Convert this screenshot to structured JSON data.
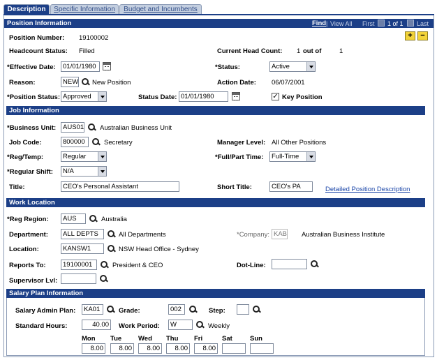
{
  "tabs": [
    "Description",
    "Specific Information",
    "Budget and Incumbents"
  ],
  "position_info": {
    "header": "Position Information",
    "nav": {
      "find": "Find",
      "view_all": "View All",
      "first": "First",
      "range": "1 of 1",
      "last": "Last"
    },
    "position_number_label": "Position Number:",
    "position_number": "19100002",
    "headcount_status_label": "Headcount Status:",
    "headcount_status": "Filled",
    "current_head_count_label": "Current Head Count:",
    "current_head_count": "1",
    "out_of_label": "out of",
    "max_head_count": "1",
    "effective_date_label": "*Effective Date:",
    "effective_date": "01/01/1980",
    "status_label": "*Status:",
    "status": "Active",
    "reason_label": "Reason:",
    "reason_code": "NEW",
    "reason_desc": "New Position",
    "action_date_label": "Action Date:",
    "action_date": "06/07/2001",
    "position_status_label": "*Position Status:",
    "position_status": "Approved",
    "status_date_label": "Status Date:",
    "status_date": "01/01/1980",
    "key_position_label": "Key Position",
    "key_position_checked": "✓"
  },
  "job_info": {
    "header": "Job Information",
    "business_unit_label": "*Business Unit:",
    "business_unit": "AUS01",
    "business_unit_desc": "Australian Business Unit",
    "job_code_label": "Job Code:",
    "job_code": "800000",
    "job_code_desc": "Secretary",
    "manager_level_label": "Manager Level:",
    "manager_level": "All Other Positions",
    "reg_temp_label": "*Reg/Temp:",
    "reg_temp": "Regular",
    "full_part_label": "*Full/Part Time:",
    "full_part": "Full-Time",
    "regular_shift_label": "*Regular Shift:",
    "regular_shift": "N/A",
    "title_label": "Title:",
    "title": "CEO's Personal Assistant",
    "short_title_label": "Short Title:",
    "short_title": "CEO's PA",
    "detailed_link": "Detailed Position Description"
  },
  "work_location": {
    "header": "Work Location",
    "reg_region_label": "*Reg Region:",
    "reg_region": "AUS",
    "reg_region_desc": "Australia",
    "department_label": "Department:",
    "department": "ALL DEPTS",
    "department_desc": "All Departments",
    "company_label": "*Company:",
    "company": "KAB",
    "company_desc": "Australian Business Institute",
    "location_label": "Location:",
    "location": "KANSW1",
    "location_desc": "NSW Head Office - Sydney",
    "reports_to_label": "Reports To:",
    "reports_to": "19100001",
    "reports_to_desc": "President & CEO",
    "dot_line_label": "Dot-Line:",
    "dot_line": "",
    "supervisor_lvl_label": "Supervisor Lvl:",
    "supervisor_lvl": ""
  },
  "salary_plan": {
    "header": "Salary Plan Information",
    "admin_plan_label": "Salary Admin Plan:",
    "admin_plan": "KA01",
    "grade_label": "Grade:",
    "grade": "002",
    "step_label": "Step:",
    "step": "",
    "std_hours_label": "Standard Hours:",
    "std_hours": "40.00",
    "work_period_label": "Work Period:",
    "work_period": "W",
    "work_period_desc": "Weekly",
    "days": [
      {
        "label": "Mon",
        "hours": "8.00"
      },
      {
        "label": "Tue",
        "hours": "8.00"
      },
      {
        "label": "Wed",
        "hours": "8.00"
      },
      {
        "label": "Thu",
        "hours": "8.00"
      },
      {
        "label": "Fri",
        "hours": "8.00"
      },
      {
        "label": "Sat",
        "hours": ""
      },
      {
        "label": "Sun",
        "hours": ""
      }
    ]
  }
}
